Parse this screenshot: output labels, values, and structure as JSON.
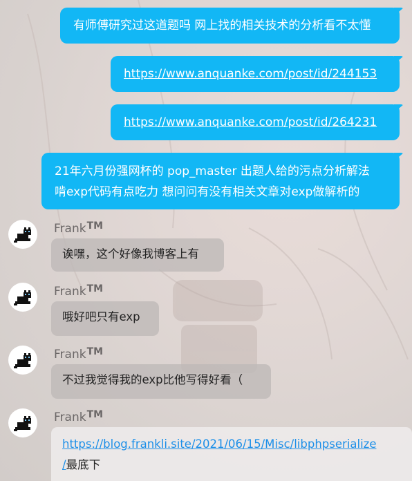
{
  "messages_out": [
    {
      "text": "有师傅研究过这道题吗 网上找的相关技术的分析看不太懂"
    },
    {
      "text": "https://www.anquanke.com/post/id/244153"
    },
    {
      "text": "https://www.anquanke.com/post/id/264231"
    },
    {
      "line1": "21年六月份强网杯的 pop_master 出题人给的污点分析解法",
      "line2": "啃exp代码有点吃力 想问问有没有相关文章对exp做解析的"
    }
  ],
  "sender": {
    "name": "Frank",
    "badge": "TM"
  },
  "messages_in": [
    {
      "text": "诶嘿，这个好像我博客上有"
    },
    {
      "text": "哦好吧只有exp"
    },
    {
      "text": "不过我觉得我的exp比他写得好看（"
    },
    {
      "link_line1": "https://blog.frankli.site/2021/06/15/Misc/libphpserialize",
      "link_line2": "/",
      "tail": "最底下"
    }
  ],
  "colors": {
    "outgoing_bubble": "#12b7f5",
    "link": "#1c8fe8"
  },
  "icons": [
    "pixel-cat-avatar-icon"
  ]
}
